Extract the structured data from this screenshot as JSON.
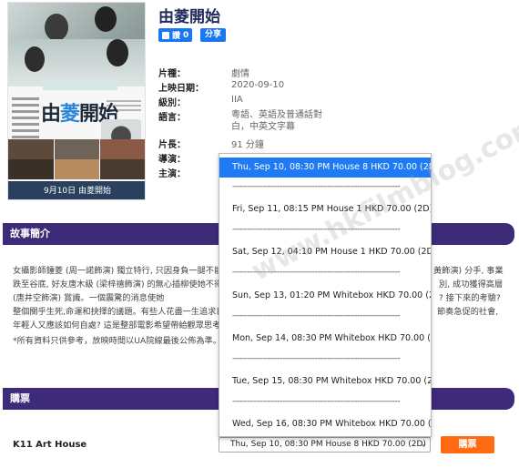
{
  "movie": {
    "title": "由菱開始",
    "poster": {
      "title_start": "由",
      "title_accent": "菱",
      "title_end": "開始",
      "release_text": "9月10日 由菱開始"
    },
    "like_count": "0",
    "like_label": "讚",
    "share_label": "分享"
  },
  "info": [
    {
      "label": "片種：",
      "value": "劇情"
    },
    {
      "label": "上映日期：",
      "value": "2020-09-10"
    },
    {
      "label": "級別：",
      "value": "IIA"
    },
    {
      "label": "語言：",
      "value": "粵語、英語及普通話對白，中英文字幕"
    },
    {
      "label": "片長：",
      "value": "91 分鐘"
    },
    {
      "label": "導演：",
      "value": "蕭傑"
    },
    {
      "label": "主演：",
      "value": ""
    }
  ],
  "sections": {
    "story_title": "故事簡介",
    "ticket_title": "購票"
  },
  "synopsis": {
    "line1": "女攝影師鍾菱 (周一諾飾演) 獨立特行, 只因身負一腿不能",
    "line1_right": "黃飾演) 分手, 事業",
    "line2": "跌至谷底, 好友唐木級 (梁梓禧飾演) 的無心插柳使她不得",
    "line2_right": "別, 成功獲得高層",
    "line3": "(唐井空飾演) 賞識。一個震驚的消息使她",
    "line3_right": "? 接下來的考驗?",
    "line4": "整個關乎生死,命運和抉擇的議題。有些人花盡一生追求目",
    "line4_right": "節奏急促的社會,",
    "line5": "年輕人又應該如何自處? 這是整部電影希望帶給觀眾思考",
    "note": "*所有資料只供參考，放映時間以UA院線最後公佈為準。"
  },
  "ticket": {
    "house": "K11 Art House",
    "selected_session": "Thu, Sep 10, 08:30 PM House 8 HKD 70.00 (2D)",
    "buy_label": "購票"
  },
  "dropdown": {
    "options": [
      "Thu, Sep 10, 08:30 PM House 8 HKD 70.00 (2D)",
      "Fri, Sep 11, 08:15 PM House 1 HKD 70.00 (2D)",
      "Sat, Sep 12, 04:10 PM House 1 HKD 70.00 (2D)",
      "Sun, Sep 13, 01:20 PM Whitebox HKD 70.00 (2D)",
      "Mon, Sep 14, 08:30 PM Whitebox HKD 70.00 (2D)",
      "Tue, Sep 15, 08:30 PM Whitebox HKD 70.00 (2D)",
      "Wed, Sep 16, 08:30 PM Whitebox HKD 70.00 (2D)"
    ],
    "separator": "-------------------------------------------------------------------"
  },
  "watermark": "www.hkfilmblog.com",
  "colors": {
    "accent": "#3d2a78",
    "title": "#1f2a5a",
    "facebook": "#1877f2",
    "buy": "#ff6a13",
    "selected_option": "#1e7bf5"
  }
}
